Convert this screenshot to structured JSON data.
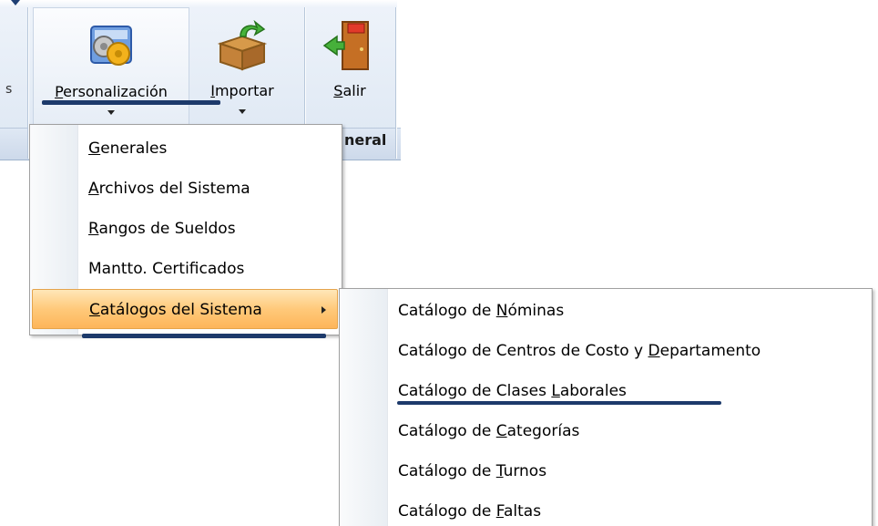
{
  "ribbon": {
    "buttons": [
      {
        "key": "personalizacion",
        "label_accel": "P",
        "label_rest_a": "e",
        "label_accel2": "r",
        "label_rest": "sonalización",
        "icon": "gears-tools-icon"
      },
      {
        "key": "importar",
        "label_accel": "I",
        "label_rest": "mportar",
        "icon": "open-box-import-icon"
      },
      {
        "key": "salir",
        "label_accel": "S",
        "label_rest": "alir",
        "icon": "exit-door-icon"
      }
    ],
    "group_caption": "neral",
    "left_cut_label": "s"
  },
  "menu": {
    "items": [
      {
        "accel": "G",
        "rest": "enerales"
      },
      {
        "accel": "A",
        "rest": "rchivos del Sistema"
      },
      {
        "accel": "R",
        "rest": "angos de Sueldos"
      },
      {
        "accel": "",
        "rest": "Mantto. Certificados"
      },
      {
        "accel": "C",
        "rest": "atálogos del Sistema",
        "has_submenu": true,
        "highlighted": true
      }
    ]
  },
  "submenu": {
    "items": [
      {
        "pre": "Catálogo de ",
        "accel": "N",
        "rest": "óminas"
      },
      {
        "pre": "Catálogo de Centros de Costo y ",
        "accel": "D",
        "rest": "epartamento"
      },
      {
        "pre": "Catálogo de Clases ",
        "accel": "L",
        "rest": "aborales"
      },
      {
        "pre": "Catálogo de ",
        "accel": "C",
        "rest": "ategorías"
      },
      {
        "pre": "Catálogo de ",
        "accel": "T",
        "rest": "urnos"
      },
      {
        "pre": "Catálogo de ",
        "accel": "F",
        "rest": "altas"
      }
    ]
  },
  "colors": {
    "highlight": "#ffc97a",
    "ink": "#1d3a6b",
    "ribbon": "#dde7f3"
  }
}
